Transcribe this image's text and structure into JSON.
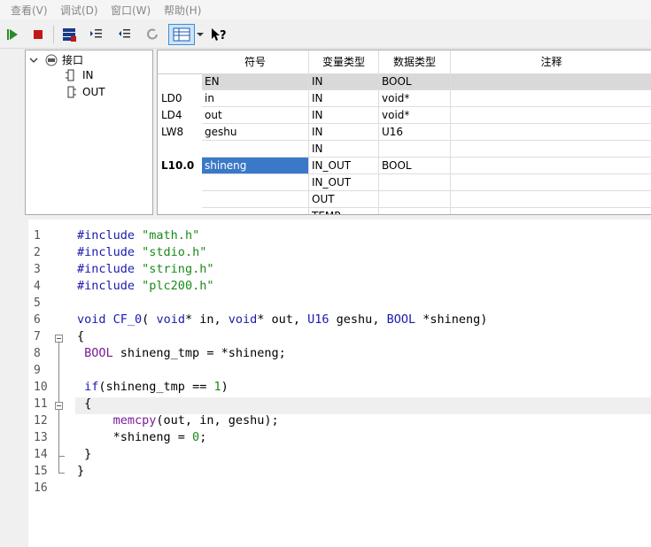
{
  "menu": [
    "查看(V)",
    "调试(D)",
    "窗口(W)",
    "帮助(H)"
  ],
  "tree": {
    "root": "接口",
    "children": [
      "IN",
      "OUT"
    ]
  },
  "grid": {
    "headers": [
      "符号",
      "变量类型",
      "数据类型",
      "注释"
    ],
    "rows": [
      {
        "addr": "",
        "symbol": "EN",
        "var_type": "IN",
        "data_type": "BOOL",
        "comment": ""
      },
      {
        "addr": "LD0",
        "symbol": "in",
        "var_type": "IN",
        "data_type": "void*",
        "comment": ""
      },
      {
        "addr": "LD4",
        "symbol": "out",
        "var_type": "IN",
        "data_type": "void*",
        "comment": ""
      },
      {
        "addr": "LW8",
        "symbol": "geshu",
        "var_type": "IN",
        "data_type": "U16",
        "comment": ""
      },
      {
        "addr": "",
        "symbol": "",
        "var_type": "IN",
        "data_type": "",
        "comment": ""
      },
      {
        "addr": "L10.0",
        "symbol": "shineng",
        "var_type": "IN_OUT",
        "data_type": "BOOL",
        "comment": ""
      },
      {
        "addr": "",
        "symbol": "",
        "var_type": "IN_OUT",
        "data_type": "",
        "comment": ""
      },
      {
        "addr": "",
        "symbol": "",
        "var_type": "OUT",
        "data_type": "",
        "comment": ""
      },
      {
        "addr": "",
        "symbol": "",
        "var_type": "TEMP",
        "data_type": "",
        "comment": ""
      }
    ]
  },
  "code": {
    "lines": [
      "#include \"math.h\"",
      "#include \"stdio.h\"",
      "#include \"string.h\"",
      "#include \"plc200.h\"",
      "",
      "void CF_0( void* in, void* out, U16 geshu, BOOL *shineng)",
      "{",
      " BOOL shineng_tmp = *shineng;",
      "",
      " if(shineng_tmp == 1)",
      " {",
      "     memcpy(out, in, geshu);",
      "     *shineng = 0;",
      " }",
      "}",
      ""
    ]
  },
  "colors": {
    "selection": "#3a78c8",
    "keyword": "#1a1ab0",
    "string": "#1a8a1a",
    "function": "#7a1a9a",
    "current_line": "#efefef"
  }
}
